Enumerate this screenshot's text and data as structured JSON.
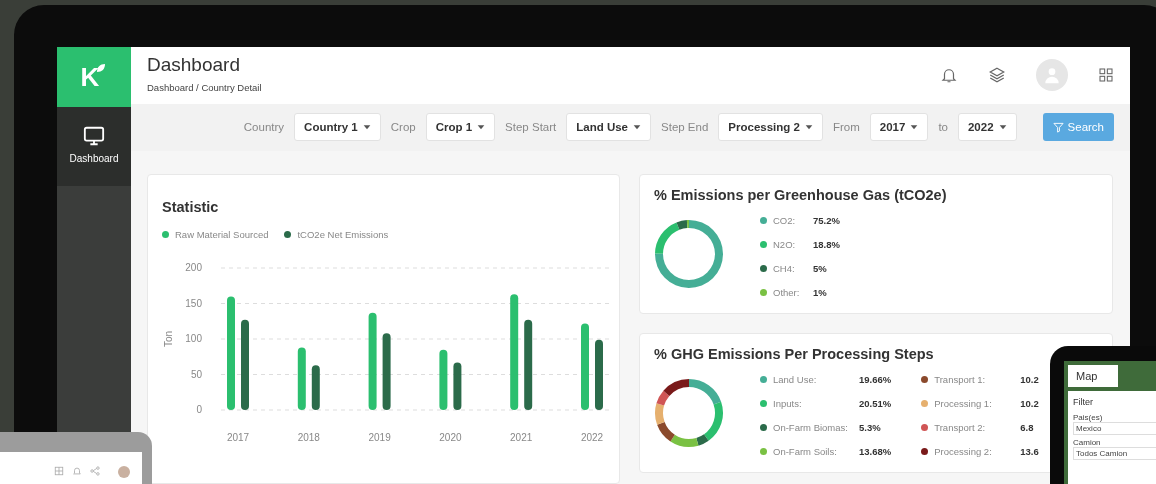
{
  "sidebar": {
    "logo": "K",
    "items": [
      {
        "label": "Dashboard",
        "selected": true
      }
    ]
  },
  "header": {
    "title": "Dashboard",
    "breadcrumb": "Dashboard / Country Detail"
  },
  "filters": [
    {
      "label": "Country",
      "value": "Country 1"
    },
    {
      "label": "Crop",
      "value": "Crop 1"
    },
    {
      "label": "Step Start",
      "value": "Land Use"
    },
    {
      "label": "Step End",
      "value": "Processing 2"
    },
    {
      "label": "From",
      "value": "2017"
    },
    {
      "label": "to",
      "value": "2022"
    }
  ],
  "search_button": "Search",
  "statistic": {
    "title": "Statistic",
    "chart_data": {
      "type": "bar",
      "grid": true,
      "ylabel": "Ton",
      "categories": [
        "2017",
        "2018",
        "2019",
        "2020",
        "2021",
        "2022"
      ],
      "ylim": [
        0,
        200
      ],
      "yticks": [
        0,
        50,
        100,
        150,
        200
      ],
      "series": [
        {
          "name": "Raw Material Sourced",
          "color": "#2bbf6f",
          "values": [
            160,
            88,
            137,
            85,
            163,
            122
          ]
        },
        {
          "name": "tCO2e Net Emissions",
          "color": "#2b6b4a",
          "values": [
            127,
            63,
            108,
            67,
            127,
            99
          ]
        }
      ]
    }
  },
  "gas_card": {
    "title": "% Emissions per Greenhouse Gas (tCO2e)",
    "legend": [
      {
        "label": "CO2:",
        "value": "75.2%",
        "color": "#45ae96"
      },
      {
        "label": "N2O:",
        "value": "18.8%",
        "color": "#2bbf6f"
      },
      {
        "label": "CH4:",
        "value": "5%",
        "color": "#2b6b4a"
      },
      {
        "label": "Other:",
        "value": "1%",
        "color": "#7ac143"
      }
    ],
    "chart_data": {
      "type": "donut",
      "values": [
        75.2,
        18.8,
        5,
        1
      ]
    }
  },
  "steps_card": {
    "title": "% GHG Emissions Per Processing Steps",
    "legend": [
      {
        "label": "Land Use:",
        "value": "19.66%",
        "color": "#45ae96"
      },
      {
        "label": "Inputs:",
        "value": "20.51%",
        "color": "#2bbf6f"
      },
      {
        "label": "On-Farm Biomas:",
        "value": "5.3%",
        "color": "#2b6b4a"
      },
      {
        "label": "On-Farm Soils:",
        "value": "13.68%",
        "color": "#7ac143"
      },
      {
        "label": "Transport 1:",
        "value": "10.2",
        "color": "#8b4a2c"
      },
      {
        "label": "Processing 1:",
        "value": "10.2",
        "color": "#e6b06e"
      },
      {
        "label": "Transport 2:",
        "value": "6.8",
        "color": "#d05555"
      },
      {
        "label": "Processing 2:",
        "value": "13.6",
        "color": "#7a1a1a"
      }
    ],
    "chart_data": {
      "type": "donut",
      "values": [
        19.66,
        20.51,
        5.3,
        13.68,
        10.2,
        10.2,
        6.8,
        13.6
      ]
    }
  },
  "tablet": {
    "tab": "Map",
    "panel_title": "Filter",
    "fields": [
      {
        "label": "Pais(es)",
        "value": "Mexico"
      },
      {
        "label": "Camion",
        "value": "Todos Camion"
      }
    ]
  }
}
